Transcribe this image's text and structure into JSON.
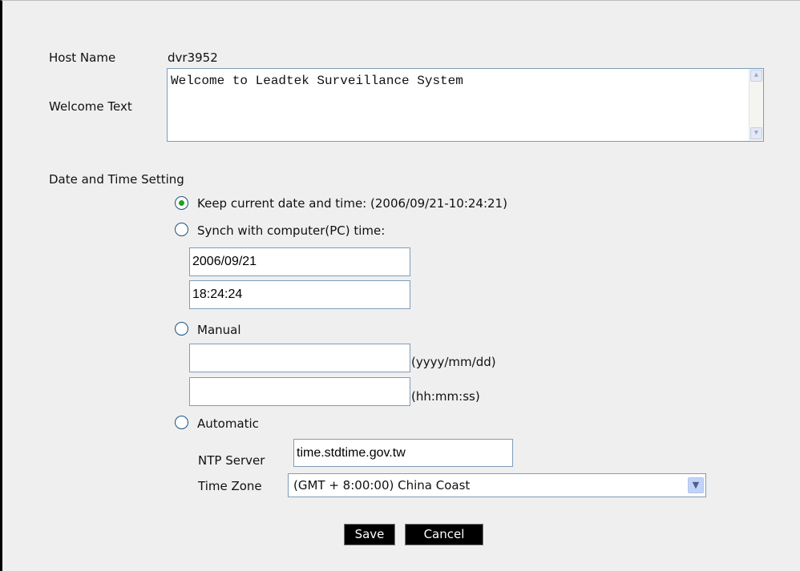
{
  "host_name": {
    "label": "Host Name",
    "value": "dvr3952"
  },
  "welcome_text": {
    "label": "Welcome Text",
    "value": "Welcome to Leadtek Surveillance System"
  },
  "date_time": {
    "section_label": "Date and Time Setting",
    "keep_current": {
      "label": "Keep current date and time: (2006/09/21-10:24:21)",
      "selected": true
    },
    "synch_pc": {
      "label": "Synch with computer(PC) time:",
      "date_value": "2006/09/21",
      "time_value": "18:24:24"
    },
    "manual": {
      "label": "Manual",
      "date_value": "",
      "date_hint": "(yyyy/mm/dd)",
      "time_value": "",
      "time_hint": "(hh:mm:ss)"
    },
    "automatic": {
      "label": "Automatic",
      "ntp_label": "NTP Server",
      "ntp_value": "time.stdtime.gov.tw",
      "tz_label": "Time Zone",
      "tz_value": "(GMT + 8:00:00) China Coast"
    }
  },
  "buttons": {
    "save": "Save",
    "cancel": "Cancel"
  },
  "colors": {
    "panel_bg": "#efefef",
    "button_bg": "#000000",
    "radio_selected": "#21a121",
    "field_border": "#7f9db9"
  }
}
